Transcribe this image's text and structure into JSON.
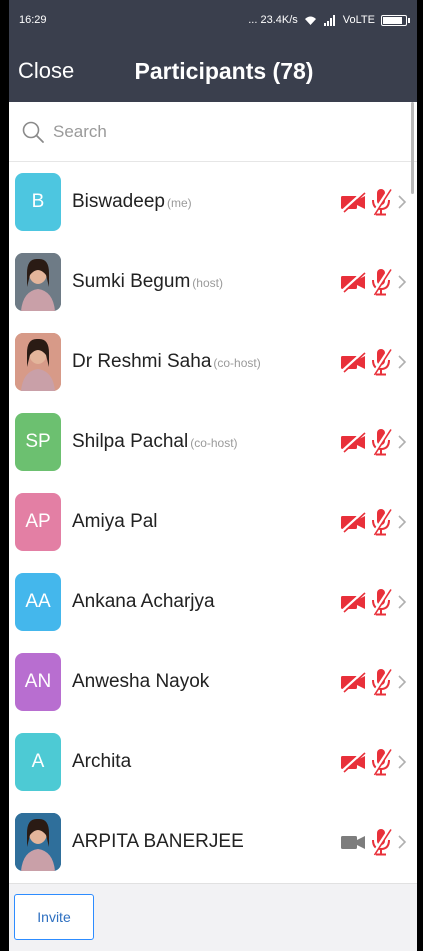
{
  "status_bar": {
    "time": "16:29",
    "speed": "... 23.4K/s",
    "network": "VoLTE"
  },
  "header": {
    "close_label": "Close",
    "title": "Participants (78)"
  },
  "search": {
    "placeholder": "Search"
  },
  "participants": [
    {
      "initials": "B",
      "name": "Biswadeep",
      "role": "(me)",
      "avatar_color": "#4dc6e0",
      "photo": false,
      "camera": "off",
      "mic": "muted"
    },
    {
      "initials": "",
      "name": "Sumki Begum",
      "role": "(host)",
      "avatar_color": "#6e7b86",
      "photo": true,
      "camera": "off",
      "mic": "muted"
    },
    {
      "initials": "",
      "name": "Dr Reshmi Saha",
      "role": "(co-host)",
      "avatar_color": "#d79a88",
      "photo": true,
      "camera": "off",
      "mic": "muted"
    },
    {
      "initials": "SP",
      "name": "Shilpa Pachal",
      "role": "(co-host)",
      "avatar_color": "#6cc070",
      "photo": false,
      "camera": "off",
      "mic": "muted"
    },
    {
      "initials": "AP",
      "name": "Amiya Pal",
      "role": "",
      "avatar_color": "#e37fa4",
      "photo": false,
      "camera": "off",
      "mic": "muted"
    },
    {
      "initials": "AA",
      "name": "Ankana Acharjya",
      "role": "",
      "avatar_color": "#44b7ec",
      "photo": false,
      "camera": "off",
      "mic": "muted"
    },
    {
      "initials": "AN",
      "name": "Anwesha Nayok",
      "role": "",
      "avatar_color": "#b86ed0",
      "photo": false,
      "camera": "off",
      "mic": "muted"
    },
    {
      "initials": "A",
      "name": "Archita",
      "role": "",
      "avatar_color": "#4dcad4",
      "photo": false,
      "camera": "off",
      "mic": "muted"
    },
    {
      "initials": "",
      "name": "ARPITA BANERJEE",
      "role": "",
      "avatar_color": "#2f6f9b",
      "photo": true,
      "camera": "on",
      "mic": "muted"
    }
  ],
  "footer": {
    "invite_label": "Invite"
  },
  "colors": {
    "header_bg": "#3a3f4d",
    "muted_red": "#e8303a",
    "camera_on_gray": "#7d7d7d",
    "invite_blue": "#2d8cff"
  }
}
